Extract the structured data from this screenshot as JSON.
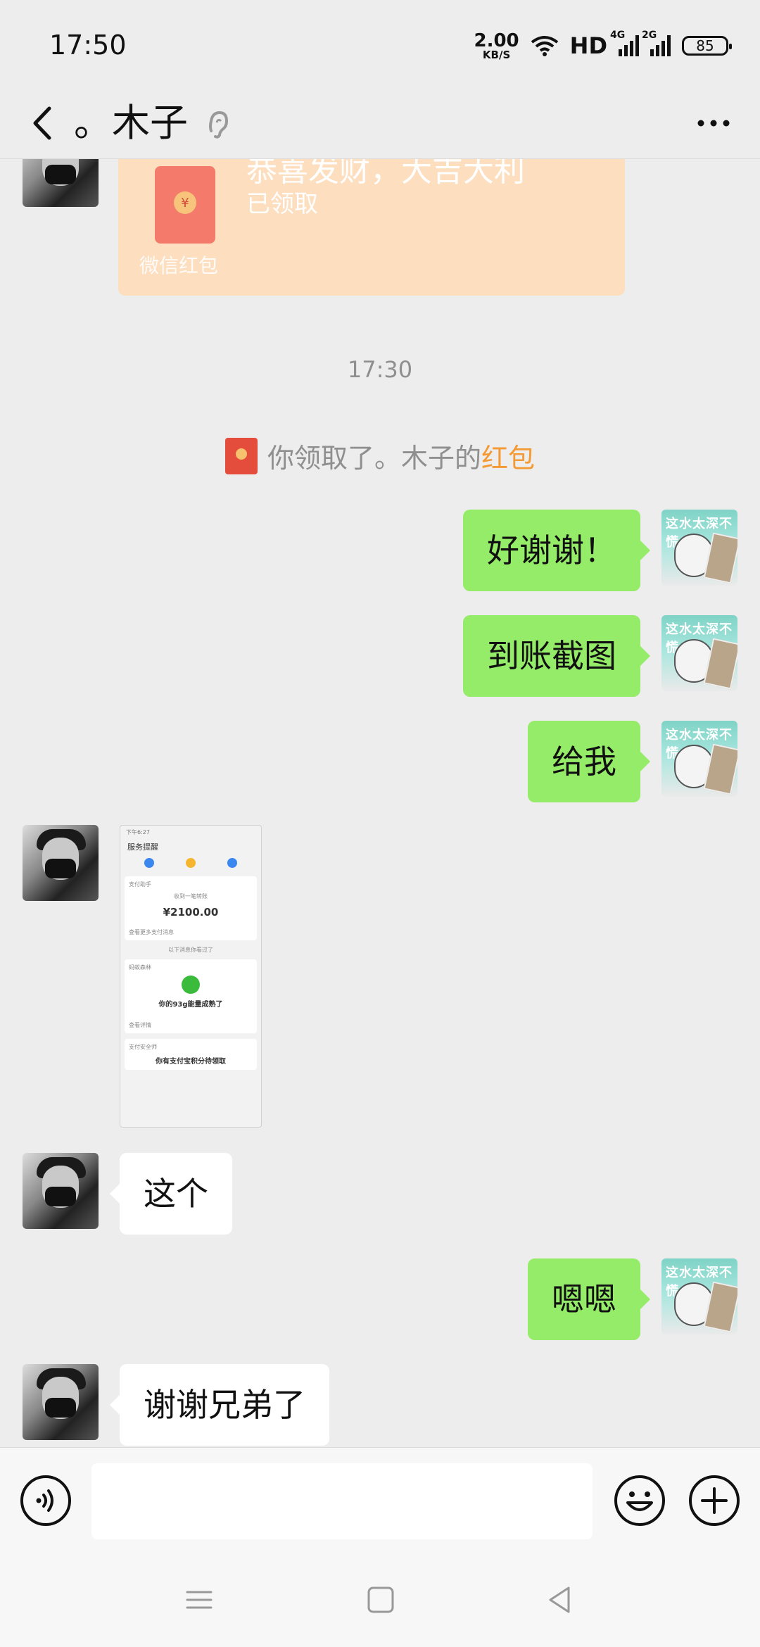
{
  "status_bar": {
    "time": "17:50",
    "speed_value": "2.00",
    "speed_unit": "KB/S",
    "hd_label": "HD",
    "network_1": "4G",
    "network_2": "2G",
    "battery": "85"
  },
  "header": {
    "title": "。木子"
  },
  "red_envelope": {
    "title": "恭喜发财，大吉大利",
    "status": "已领取",
    "footer": "微信红包",
    "coin": "¥"
  },
  "timestamp": "17:30",
  "system_notice": {
    "prefix": "你领取了。木子的",
    "link": "红包"
  },
  "messages": [
    {
      "side": "right",
      "text": "好谢谢！"
    },
    {
      "side": "right",
      "text": "到账截图"
    },
    {
      "side": "right",
      "text": "给我"
    },
    {
      "side": "left",
      "text": "这个"
    },
    {
      "side": "right",
      "text": "嗯嗯"
    },
    {
      "side": "left",
      "text": "谢谢兄弟了"
    }
  ],
  "screenshot_image": {
    "status": "下午6:27",
    "nav_title": "服务提醒",
    "card1_title": "支付助手",
    "card1_caption": "收到一笔转账",
    "amount": "¥2100.00",
    "card1_link": "查看更多支付消息",
    "divider": "以下消息你看过了",
    "card2_title": "蚂蚁森林",
    "card2_text": "你的93g能量成熟了",
    "card2_link": "查看详情",
    "card3_title": "支付安全师",
    "card3_text": "你有支付宝积分待领取"
  },
  "avatar_right_text": "这水太深不慌"
}
